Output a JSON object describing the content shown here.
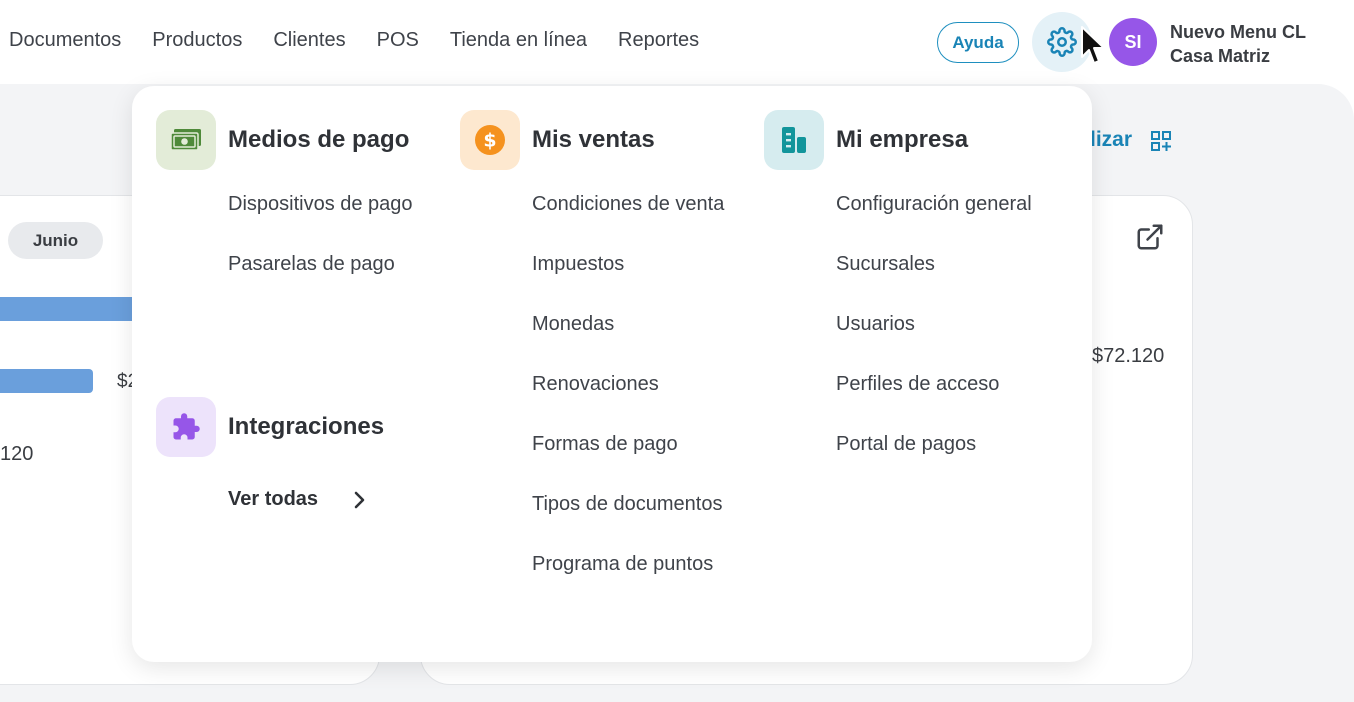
{
  "nav": {
    "items": [
      "Documentos",
      "Productos",
      "Clientes",
      "POS",
      "Tienda en línea",
      "Reportes"
    ]
  },
  "header": {
    "help_label": "Ayuda",
    "avatar_initials": "SI",
    "account_name": "Nuevo Menu CL",
    "branch_name": "Casa Matriz",
    "settings_icon": "gear-icon"
  },
  "background": {
    "month_label": "Junio",
    "bar_label": "$2",
    "left_value": "120",
    "right_value": "$72.120",
    "personalize_label": "lizar"
  },
  "menu": {
    "payment": {
      "title": "Medios de pago",
      "icon": "cash-icon",
      "items": [
        "Dispositivos de pago",
        "Pasarelas de pago"
      ]
    },
    "sales": {
      "title": "Mis ventas",
      "icon": "dollar-coin-icon",
      "items": [
        "Condiciones de venta",
        "Impuestos",
        "Monedas",
        "Renovaciones",
        "Formas de pago",
        "Tipos de documentos",
        "Programa de puntos"
      ]
    },
    "company": {
      "title": "Mi empresa",
      "icon": "building-icon",
      "items": [
        "Configuración general",
        "Sucursales",
        "Usuarios",
        "Perfiles de acceso",
        "Portal de pagos"
      ]
    },
    "integrations": {
      "title": "Integraciones",
      "icon": "puzzle-icon",
      "see_all": "Ver todas"
    }
  },
  "colors": {
    "accent": "#1a84b6",
    "avatar": "#9656e8",
    "payment_icon_bg": "#e3ecd8",
    "sales_icon_bg": "#fde8cf",
    "company_icon_bg": "#d6ecef",
    "integrations_icon_bg": "#ede3fb"
  }
}
